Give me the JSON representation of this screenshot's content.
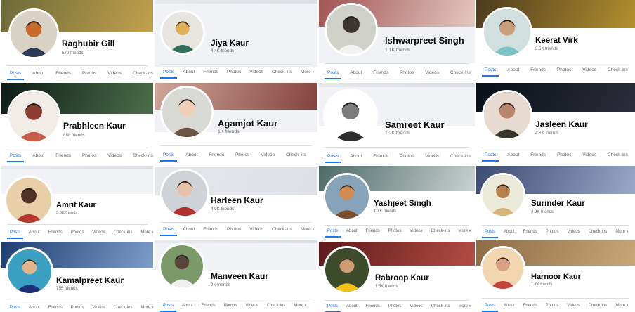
{
  "tabs": {
    "posts": "Posts",
    "about": "About",
    "friends": "Friends",
    "photos": "Photos",
    "videos": "Videos",
    "checkins": "Check-ins",
    "more": "More",
    "more_caret": "▾"
  },
  "profiles": [
    {
      "name": "Raghubir Gill",
      "friends": "579 friends"
    },
    {
      "name": "Jiya Kaur",
      "friends": "4.4K friends"
    },
    {
      "name": "Ishwarpreet Singh",
      "friends": "1.1K friends"
    },
    {
      "name": "Keerat Virk",
      "friends": "3.6K friends"
    },
    {
      "name": "Prabhleen Kaur",
      "friends": "888 friends"
    },
    {
      "name": "Agamjot Kaur",
      "friends": "1K friends"
    },
    {
      "name": "Samreet Kaur",
      "friends": "1.2K friends"
    },
    {
      "name": "Jasleen Kaur",
      "friends": "4.8K friends"
    },
    {
      "name": "Amrit Kaur",
      "friends": "3.3K friends"
    },
    {
      "name": "Harleen Kaur",
      "friends": "4.9K friends"
    },
    {
      "name": "Yashjeet Singh",
      "friends": "1.1K friends"
    },
    {
      "name": "Surinder Kaur",
      "friends": "4.9K friends"
    },
    {
      "name": "Kamalpreet Kaur",
      "friends": "755 friends"
    },
    {
      "name": "Manveen Kaur",
      "friends": "2K friends"
    },
    {
      "name": "Rabroop Kaur",
      "friends": "1.5K friends"
    },
    {
      "name": "Harnoor Kaur",
      "friends": "1.7K friends"
    }
  ],
  "colors": {
    "accent": "#1877f2",
    "name_text": "#050505",
    "secondary_text": "#65676b",
    "page_grey": "#f0f2f5"
  }
}
